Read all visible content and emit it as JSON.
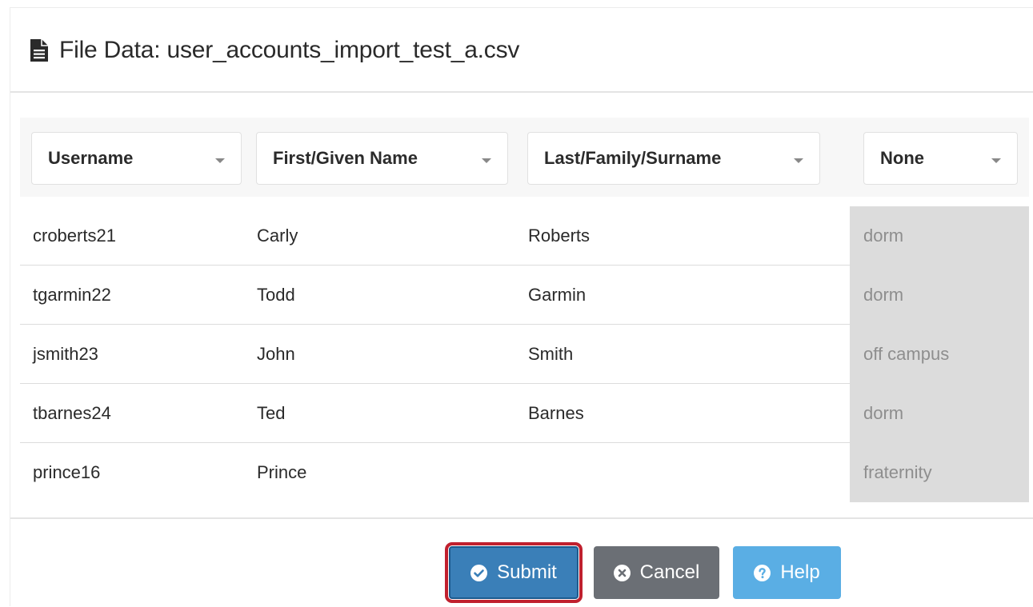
{
  "header": {
    "title": "File Data: user_accounts_import_test_a.csv",
    "icon": "file-text-icon"
  },
  "columns": [
    {
      "label": "Username"
    },
    {
      "label": "First/Given Name"
    },
    {
      "label": "Last/Family/Surname"
    },
    {
      "label": "None"
    }
  ],
  "rows": [
    [
      "croberts21",
      "Carly",
      "Roberts",
      "dorm"
    ],
    [
      "tgarmin22",
      "Todd",
      "Garmin",
      "dorm"
    ],
    [
      "jsmith23",
      "John",
      "Smith",
      "off campus"
    ],
    [
      "tbarnes24",
      "Ted",
      "Barnes",
      "dorm"
    ],
    [
      "prince16",
      "Prince",
      "",
      "fraternity"
    ]
  ],
  "actions": {
    "submit_label": "Submit",
    "cancel_label": "Cancel",
    "help_label": "Help"
  },
  "colors": {
    "submit": "#3a7fb8",
    "cancel": "#6b6f75",
    "help": "#5aaee4",
    "highlight": "#c0202e",
    "unmapped_column": "#dcdcdc"
  }
}
